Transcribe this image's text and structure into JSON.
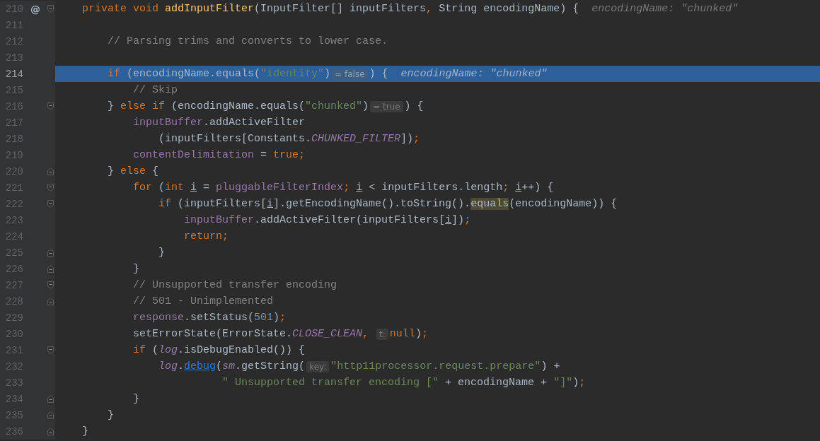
{
  "editor": {
    "lines": [
      {
        "number": "210",
        "marker": "@",
        "fold": {
          "kind": "start"
        },
        "current": false,
        "parts": [
          {
            "kind": "code",
            "tokens": [
              {
                "text": "    private void ",
                "kind": "kw"
              },
              {
                "text": "addInputFilter",
                "kind": "method"
              },
              {
                "text": "(InputFilter[] inputFilters",
                "kind": "plain"
              },
              {
                "text": ", ",
                "kind": "punct"
              },
              {
                "text": "String encodingName) {",
                "kind": "plain"
              }
            ]
          },
          {
            "kind": "value",
            "text": "encodingName: \"chunked\""
          }
        ]
      },
      {
        "number": "211",
        "current": false
      },
      {
        "number": "212",
        "current": false,
        "parts": [
          {
            "kind": "code",
            "tokens": [
              {
                "text": "        // Parsing trims and converts to lower case.",
                "kind": "comment"
              }
            ]
          }
        ]
      },
      {
        "number": "213",
        "current": false
      },
      {
        "number": "214",
        "current": true,
        "parts": [
          {
            "kind": "code",
            "tokens": [
              {
                "text": "        if ",
                "kind": "kw"
              },
              {
                "text": "(encodingName.equals(",
                "kind": "plain"
              },
              {
                "text": "\"identity\"",
                "kind": "str"
              },
              {
                "text": ")",
                "kind": "plain"
              }
            ]
          },
          {
            "kind": "hint",
            "text": "= false"
          },
          {
            "kind": "code",
            "tokens": [
              {
                "text": ") {",
                "kind": "plain"
              }
            ]
          },
          {
            "kind": "value",
            "text": "encodingName: \"chunked\""
          }
        ]
      },
      {
        "number": "215",
        "current": false,
        "parts": [
          {
            "kind": "code",
            "tokens": [
              {
                "text": "            // Skip",
                "kind": "comment"
              }
            ]
          }
        ]
      },
      {
        "number": "216",
        "fold": {
          "kind": "start"
        },
        "current": false,
        "parts": [
          {
            "kind": "code",
            "tokens": [
              {
                "text": "        } ",
                "kind": "plain"
              },
              {
                "text": "else if ",
                "kind": "kw"
              },
              {
                "text": "(encodingName.equals(",
                "kind": "plain"
              },
              {
                "text": "\"chunked\"",
                "kind": "str"
              },
              {
                "text": ")",
                "kind": "plain"
              }
            ]
          },
          {
            "kind": "hint",
            "text": "= true"
          },
          {
            "kind": "code",
            "tokens": [
              {
                "text": ") {",
                "kind": "plain"
              }
            ]
          }
        ]
      },
      {
        "number": "217",
        "current": false,
        "parts": [
          {
            "kind": "code",
            "tokens": [
              {
                "text": "            inputBuffer",
                "kind": "field"
              },
              {
                "text": ".addActiveFilter",
                "kind": "plain"
              }
            ]
          }
        ]
      },
      {
        "number": "218",
        "current": false,
        "parts": [
          {
            "kind": "code",
            "tokens": [
              {
                "text": "                (inputFilters[Constants.",
                "kind": "plain"
              },
              {
                "text": "CHUNKED_FILTER",
                "kind": "static"
              },
              {
                "text": "])",
                "kind": "plain"
              },
              {
                "text": ";",
                "kind": "punct"
              }
            ]
          }
        ]
      },
      {
        "number": "219",
        "current": false,
        "parts": [
          {
            "kind": "code",
            "tokens": [
              {
                "text": "            contentDelimitation",
                "kind": "field"
              },
              {
                "text": " = ",
                "kind": "plain"
              },
              {
                "text": "true",
                "kind": "kw"
              },
              {
                "text": ";",
                "kind": "punct"
              }
            ]
          }
        ]
      },
      {
        "number": "220",
        "fold": {
          "kind": "end"
        },
        "current": false,
        "parts": [
          {
            "kind": "code",
            "tokens": [
              {
                "text": "        } ",
                "kind": "plain"
              },
              {
                "text": "else ",
                "kind": "kw"
              },
              {
                "text": "{",
                "kind": "plain"
              }
            ]
          }
        ]
      },
      {
        "number": "221",
        "fold": {
          "kind": "start"
        },
        "current": false,
        "parts": [
          {
            "kind": "code",
            "tokens": [
              {
                "text": "            for ",
                "kind": "kw"
              },
              {
                "text": "(",
                "kind": "plain"
              },
              {
                "text": "int ",
                "kind": "kw"
              },
              {
                "text": "i",
                "kind": "var"
              },
              {
                "text": " = ",
                "kind": "plain"
              },
              {
                "text": "pluggableFilterIndex",
                "kind": "field"
              },
              {
                "text": "; ",
                "kind": "punct"
              },
              {
                "text": "i",
                "kind": "var"
              },
              {
                "text": " < inputFilters.length",
                "kind": "plain"
              },
              {
                "text": "; ",
                "kind": "punct"
              },
              {
                "text": "i",
                "kind": "var"
              },
              {
                "text": "++) {",
                "kind": "plain"
              }
            ]
          }
        ]
      },
      {
        "number": "222",
        "fold": {
          "kind": "start"
        },
        "current": false,
        "parts": [
          {
            "kind": "code",
            "tokens": [
              {
                "text": "                if ",
                "kind": "kw"
              },
              {
                "text": "(inputFilters[",
                "kind": "plain"
              },
              {
                "text": "i",
                "kind": "var"
              },
              {
                "text": "].getEncodingName().toString().",
                "kind": "plain"
              },
              {
                "text": "equals",
                "kind": "match"
              },
              {
                "text": "(encodingName)) {",
                "kind": "plain"
              }
            ]
          }
        ]
      },
      {
        "number": "223",
        "current": false,
        "parts": [
          {
            "kind": "code",
            "tokens": [
              {
                "text": "                    inputBuffer",
                "kind": "field"
              },
              {
                "text": ".addActiveFilter(inputFilters[",
                "kind": "plain"
              },
              {
                "text": "i",
                "kind": "var"
              },
              {
                "text": "])",
                "kind": "plain"
              },
              {
                "text": ";",
                "kind": "punct"
              }
            ]
          }
        ]
      },
      {
        "number": "224",
        "current": false,
        "parts": [
          {
            "kind": "code",
            "tokens": [
              {
                "text": "                    return",
                "kind": "kw"
              },
              {
                "text": ";",
                "kind": "punct"
              }
            ]
          }
        ]
      },
      {
        "number": "225",
        "fold": {
          "kind": "end"
        },
        "current": false,
        "parts": [
          {
            "kind": "code",
            "tokens": [
              {
                "text": "                }",
                "kind": "plain"
              }
            ]
          }
        ]
      },
      {
        "number": "226",
        "fold": {
          "kind": "end"
        },
        "current": false,
        "parts": [
          {
            "kind": "code",
            "tokens": [
              {
                "text": "            }",
                "kind": "plain"
              }
            ]
          }
        ]
      },
      {
        "number": "227",
        "fold": {
          "kind": "start"
        },
        "current": false,
        "parts": [
          {
            "kind": "code",
            "tokens": [
              {
                "text": "            // Unsupported transfer encoding",
                "kind": "comment"
              }
            ]
          }
        ]
      },
      {
        "number": "228",
        "fold": {
          "kind": "end"
        },
        "current": false,
        "parts": [
          {
            "kind": "code",
            "tokens": [
              {
                "text": "            // 501 - Unimplemented",
                "kind": "comment"
              }
            ]
          }
        ]
      },
      {
        "number": "229",
        "current": false,
        "parts": [
          {
            "kind": "code",
            "tokens": [
              {
                "text": "            response",
                "kind": "field"
              },
              {
                "text": ".setStatus(",
                "kind": "plain"
              },
              {
                "text": "501",
                "kind": "num"
              },
              {
                "text": ")",
                "kind": "plain"
              },
              {
                "text": ";",
                "kind": "punct"
              }
            ]
          }
        ]
      },
      {
        "number": "230",
        "current": false,
        "parts": [
          {
            "kind": "code",
            "tokens": [
              {
                "text": "            setErrorState(ErrorState.",
                "kind": "plain"
              },
              {
                "text": "CLOSE_CLEAN",
                "kind": "static"
              },
              {
                "text": ", ",
                "kind": "punct"
              }
            ]
          },
          {
            "kind": "hint",
            "text": "t:"
          },
          {
            "kind": "code",
            "tokens": [
              {
                "text": "null",
                "kind": "kw"
              },
              {
                "text": ")",
                "kind": "plain"
              },
              {
                "text": ";",
                "kind": "punct"
              }
            ]
          }
        ]
      },
      {
        "number": "231",
        "fold": {
          "kind": "start"
        },
        "current": false,
        "parts": [
          {
            "kind": "code",
            "tokens": [
              {
                "text": "            if ",
                "kind": "kw"
              },
              {
                "text": "(",
                "kind": "plain"
              },
              {
                "text": "log",
                "kind": "static"
              },
              {
                "text": ".isDebugEnabled()) {",
                "kind": "plain"
              }
            ]
          }
        ]
      },
      {
        "number": "232",
        "current": false,
        "parts": [
          {
            "kind": "code",
            "tokens": [
              {
                "text": "                log",
                "kind": "static"
              },
              {
                "text": ".",
                "kind": "plain"
              },
              {
                "text": "debug",
                "kind": "link"
              },
              {
                "text": "(",
                "kind": "plain"
              },
              {
                "text": "sm",
                "kind": "static"
              },
              {
                "text": ".getString(",
                "kind": "plain"
              }
            ]
          },
          {
            "kind": "hint",
            "text": "key:"
          },
          {
            "kind": "code",
            "tokens": [
              {
                "text": "\"http11processor.request.prepare\"",
                "kind": "str"
              },
              {
                "text": ") +",
                "kind": "plain"
              }
            ]
          }
        ]
      },
      {
        "number": "233",
        "current": false,
        "parts": [
          {
            "kind": "code",
            "tokens": [
              {
                "text": "                          \" Unsupported transfer encoding [\"",
                "kind": "str"
              },
              {
                "text": " + encodingName + ",
                "kind": "plain"
              },
              {
                "text": "\"]\"",
                "kind": "str"
              },
              {
                "text": ")",
                "kind": "plain"
              },
              {
                "text": ";",
                "kind": "punct"
              }
            ]
          }
        ]
      },
      {
        "number": "234",
        "fold": {
          "kind": "end"
        },
        "current": false,
        "parts": [
          {
            "kind": "code",
            "tokens": [
              {
                "text": "            }",
                "kind": "plain"
              }
            ]
          }
        ]
      },
      {
        "number": "235",
        "fold": {
          "kind": "end"
        },
        "current": false,
        "parts": [
          {
            "kind": "code",
            "tokens": [
              {
                "text": "        }",
                "kind": "plain"
              }
            ]
          }
        ]
      },
      {
        "number": "236",
        "fold": {
          "kind": "end"
        },
        "current": false,
        "parts": [
          {
            "kind": "code",
            "tokens": [
              {
                "text": "    }",
                "kind": "plain"
              }
            ]
          }
        ]
      }
    ]
  }
}
